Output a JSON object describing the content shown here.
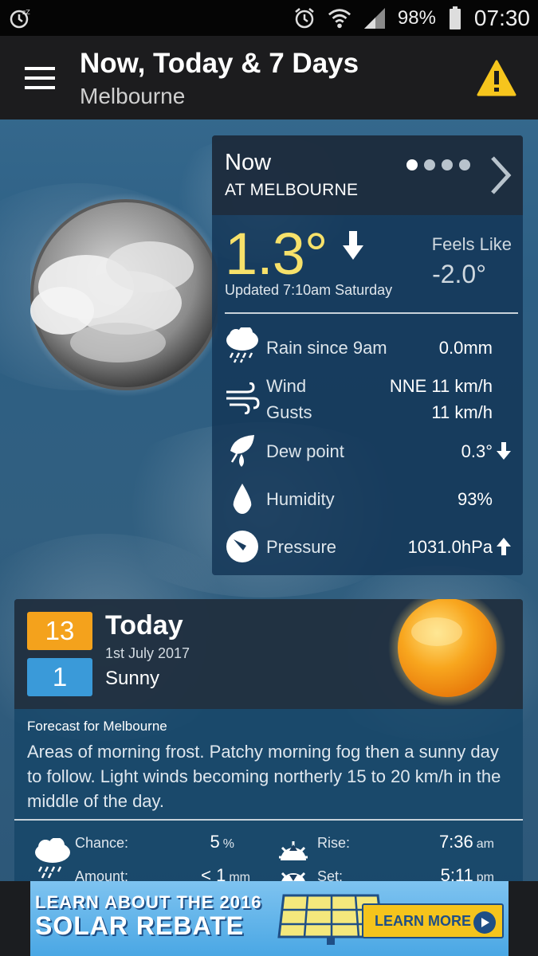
{
  "status_bar": {
    "battery_percent": "98%",
    "time": "07:30",
    "icons": [
      "sleep-mode-icon",
      "alarm-icon",
      "wifi-icon",
      "signal-icon",
      "battery-icon"
    ]
  },
  "app_bar": {
    "title": "Now, Today & 7 Days",
    "subtitle": "Melbourne",
    "icons": [
      "menu-icon",
      "warning-icon"
    ]
  },
  "now_panel": {
    "label": "Now",
    "location": "AT MELBOURNE",
    "page_dots": 4,
    "active_dot": 1,
    "temperature": "1.3°",
    "temperature_trend": "falling",
    "updated": "Updated 7:10am Saturday",
    "feels_like_label": "Feels Like",
    "feels_like_value": "-2.0°",
    "observations": [
      {
        "label": "Rain since 9am",
        "value": "0.0mm",
        "icon": "rain-cloud-icon"
      },
      {
        "label": "Wind",
        "value": "NNE 11 km/h",
        "icon": "wind-icon"
      },
      {
        "label": "Gusts",
        "value": "11 km/h"
      },
      {
        "label": "Dew point",
        "value": "0.3°",
        "icon": "dew-point-icon",
        "trend": "falling"
      },
      {
        "label": "Humidity",
        "value": "93%",
        "icon": "humidity-drop-icon"
      },
      {
        "label": "Pressure",
        "value": "1031.0hPa",
        "icon": "pressure-gauge-icon",
        "trend": "rising"
      }
    ]
  },
  "today": {
    "max": "13",
    "min": "1",
    "title": "Today",
    "date": "1st July 2017",
    "description": "Sunny",
    "forecast_label": "Forecast for Melbourne",
    "forecast_text": "Areas of morning frost. Patchy morning fog then a sunny day to follow. Light winds becoming northerly 15 to 20 km/h in the middle of the day.",
    "chance_label": "Chance:",
    "chance_value": "5",
    "chance_unit": "%",
    "amount_label": "Amount:",
    "amount_value": "< 1",
    "amount_unit": "mm",
    "rise_label": "Rise:",
    "rise_value": "7:36",
    "rise_unit": "am",
    "set_label": "Set:",
    "set_value": "5:11",
    "set_unit": "pm",
    "colors": {
      "max": "#f4a21c",
      "min": "#3a9ad9"
    }
  },
  "ad": {
    "line1": "LEARN ABOUT THE 2016",
    "line2": "SOLAR REBATE",
    "button": "LEARN MORE"
  }
}
